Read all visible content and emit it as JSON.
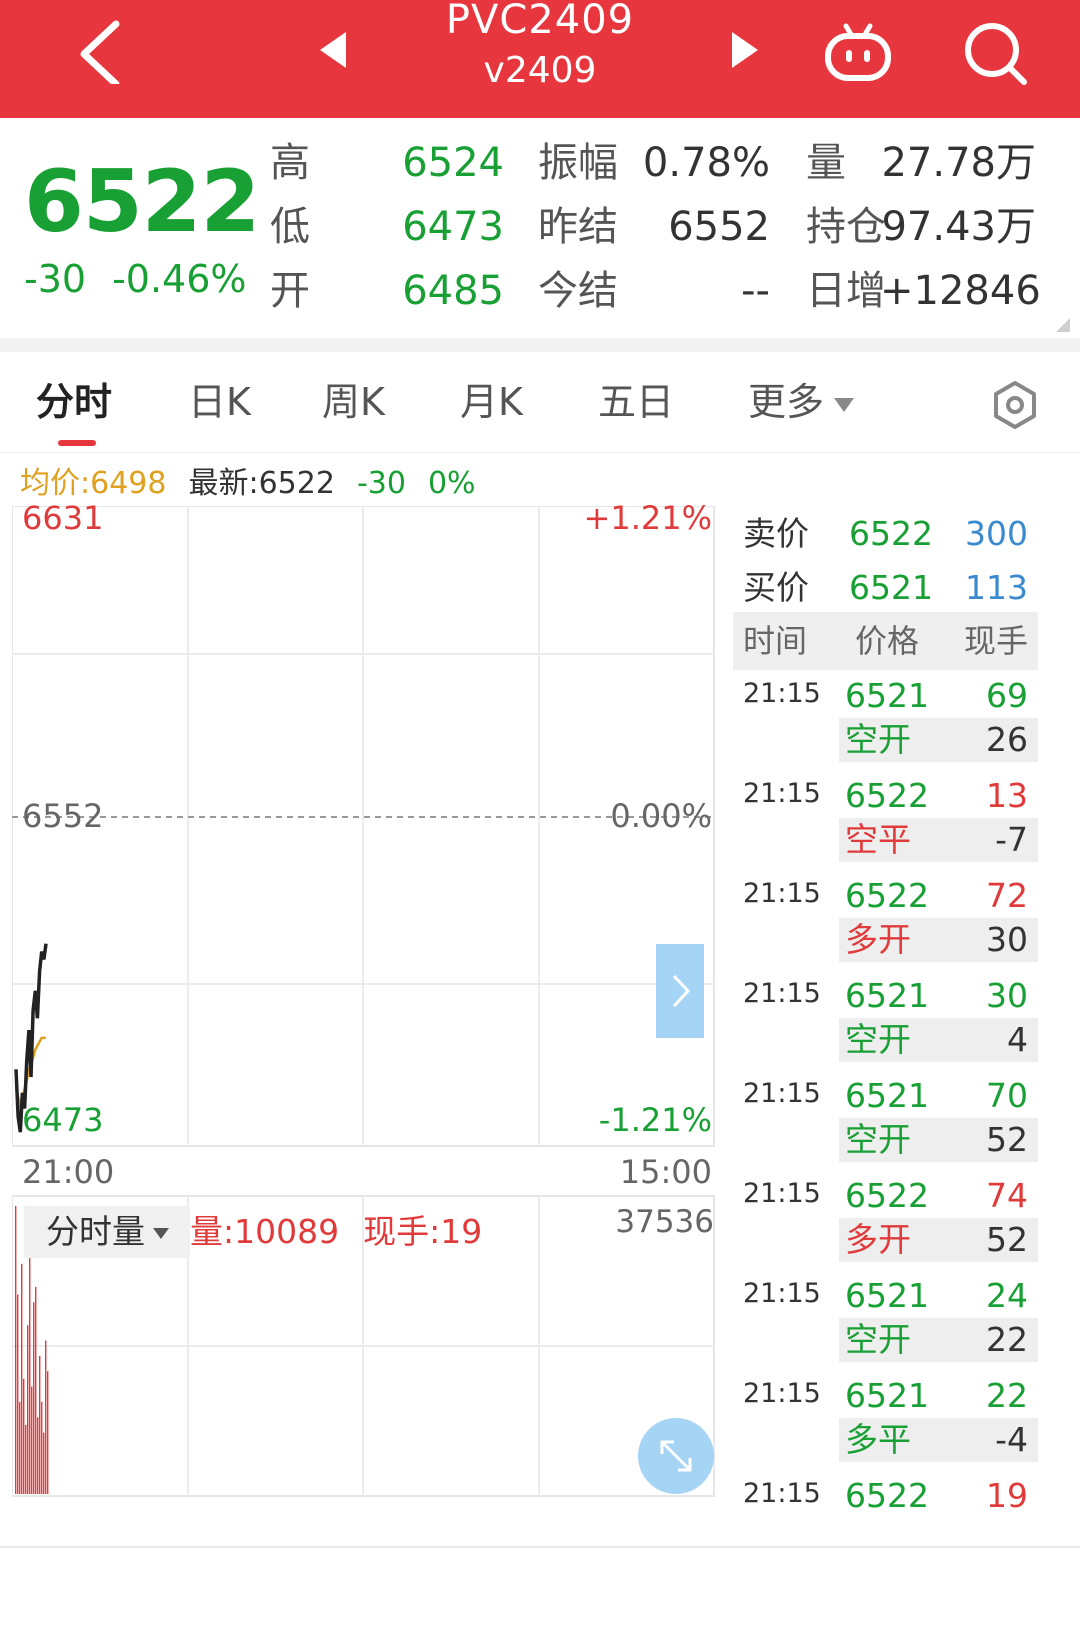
{
  "header": {
    "title": "PVC2409",
    "subtitle": "v2409",
    "bg_color": "#e8363e"
  },
  "quote": {
    "last_price": "6522",
    "change": "-30",
    "change_pct": "-0.46%",
    "rows": [
      {
        "label": "高",
        "value": "6524",
        "label2": "振幅",
        "value2": "0.78%",
        "label3": "量",
        "value3": "27.78万"
      },
      {
        "label": "低",
        "value": "6473",
        "label2": "昨结",
        "value2": "6552",
        "label3": "持仓",
        "value3": "97.43万"
      },
      {
        "label": "开",
        "value": "6485",
        "label2": "今结",
        "value2": "--",
        "label3": "日增",
        "value3": "+12846"
      }
    ]
  },
  "tabs": {
    "items": [
      "分时",
      "日K",
      "周K",
      "月K",
      "五日",
      "更多"
    ],
    "active": "分时"
  },
  "info": {
    "avg": "均价:6498",
    "latest": "最新:6522",
    "change": "-30",
    "pct": "0%"
  },
  "chart_axes": {
    "top_price": "6631",
    "top_pct": "+1.21%",
    "mid_price": "6552",
    "mid_pct": "0.00%",
    "bottom_price": "6473",
    "bottom_pct": "-1.21%",
    "start_time": "21:00",
    "end_time": "15:00"
  },
  "volume": {
    "selector": "分时量",
    "vol": "量:10089",
    "hand": "现手:19",
    "max": "37536"
  },
  "chart_data": {
    "type": "line",
    "title": "",
    "xlabel": "",
    "ylabel": "",
    "ylim": [
      6473,
      6631
    ],
    "series": [
      {
        "values": [
          6490,
          6478,
          6474,
          6484,
          6480,
          6492,
          6500,
          6488,
          6505,
          6510,
          6503,
          6515,
          6520,
          6518,
          6522
        ]
      },
      {
        "values": [
          6485,
          6483,
          6481,
          6483,
          6485,
          6487,
          6490,
          6491,
          6493,
          6495,
          6496,
          6497,
          6498,
          6498,
          6498
        ]
      }
    ],
    "volume": [
      37536,
      26000,
      12000,
      30000,
      15000,
      9000,
      22000,
      31000,
      14000,
      25000,
      27000,
      10000,
      18000,
      12000,
      8000,
      20000,
      16000
    ]
  },
  "book": {
    "ask": {
      "label": "卖价",
      "price": "6522",
      "qty": "300"
    },
    "bid": {
      "label": "买价",
      "price": "6521",
      "qty": "113"
    },
    "headers": [
      "时间",
      "价格",
      "现手"
    ],
    "ticks": [
      {
        "time": "21:15",
        "price": "6521",
        "hand": "69",
        "hand_color": "#18a034",
        "type": "空开",
        "type_color": "#18a034",
        "delta": "26"
      },
      {
        "time": "21:15",
        "price": "6522",
        "hand": "13",
        "hand_color": "#e03a3a",
        "type": "空平",
        "type_color": "#e03a3a",
        "delta": "-7"
      },
      {
        "time": "21:15",
        "price": "6522",
        "hand": "72",
        "hand_color": "#e03a3a",
        "type": "多开",
        "type_color": "#e03a3a",
        "delta": "30"
      },
      {
        "time": "21:15",
        "price": "6521",
        "hand": "30",
        "hand_color": "#18a034",
        "type": "空开",
        "type_color": "#18a034",
        "delta": "4"
      },
      {
        "time": "21:15",
        "price": "6521",
        "hand": "70",
        "hand_color": "#18a034",
        "type": "空开",
        "type_color": "#18a034",
        "delta": "52"
      },
      {
        "time": "21:15",
        "price": "6522",
        "hand": "74",
        "hand_color": "#e03a3a",
        "type": "多开",
        "type_color": "#e03a3a",
        "delta": "52"
      },
      {
        "time": "21:15",
        "price": "6521",
        "hand": "24",
        "hand_color": "#18a034",
        "type": "空开",
        "type_color": "#18a034",
        "delta": "22"
      },
      {
        "time": "21:15",
        "price": "6521",
        "hand": "22",
        "hand_color": "#18a034",
        "type": "多平",
        "type_color": "#18a034",
        "delta": "-4"
      },
      {
        "time": "21:15",
        "price": "6522",
        "hand": "19",
        "hand_color": "#e03a3a",
        "type": "",
        "type_color": "#e03a3a",
        "delta": ""
      }
    ]
  },
  "icons": {
    "back": "chevron-left-icon",
    "prev": "triangle-left-icon",
    "next": "triangle-right-icon",
    "bot": "robot-icon",
    "search": "search-icon",
    "settings": "hexagon-settings-icon",
    "expand": "chevron-right-icon",
    "fullscreen": "fullscreen-icon"
  }
}
